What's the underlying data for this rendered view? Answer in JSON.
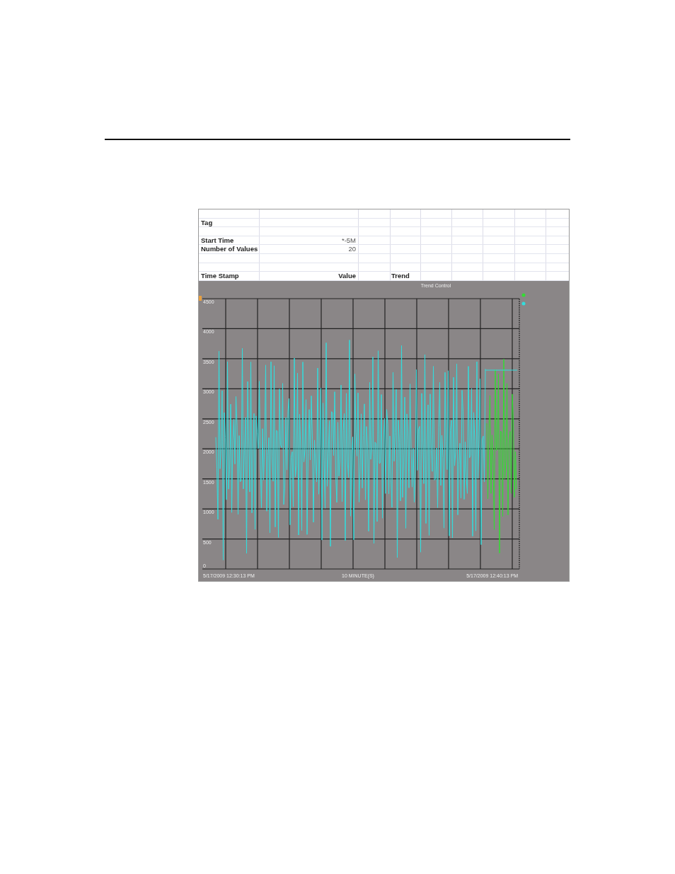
{
  "sheet": {
    "rows": [
      {
        "label": "",
        "value": "",
        "column_3": ""
      },
      {
        "label": "Tag",
        "value": "",
        "column_3": ""
      },
      {
        "label": "",
        "value": "",
        "column_3": ""
      },
      {
        "label": "Start Time",
        "value": "*-5M",
        "column_3": ""
      },
      {
        "label": "Number of Values",
        "value": "20",
        "column_3": ""
      },
      {
        "label": "",
        "value": "",
        "column_3": ""
      },
      {
        "label": "",
        "value": "",
        "column_3": ""
      },
      {
        "label": "Time Stamp",
        "value": "Value",
        "column_3": "Trend"
      }
    ]
  },
  "trend": {
    "title": "Trend Control",
    "y_labels": [
      "4500",
      "4000",
      "3500",
      "3000",
      "2500",
      "2000",
      "1500",
      "1000",
      "500",
      "0"
    ],
    "x_start": "5/17/2009 12:30:13 PM",
    "x_span": "10 MINUTE(S)",
    "x_end": "5/17/2009 12:40:13 PM",
    "pens": [
      {
        "color": "#33dd33"
      },
      {
        "color": "#33dddd"
      }
    ]
  }
}
